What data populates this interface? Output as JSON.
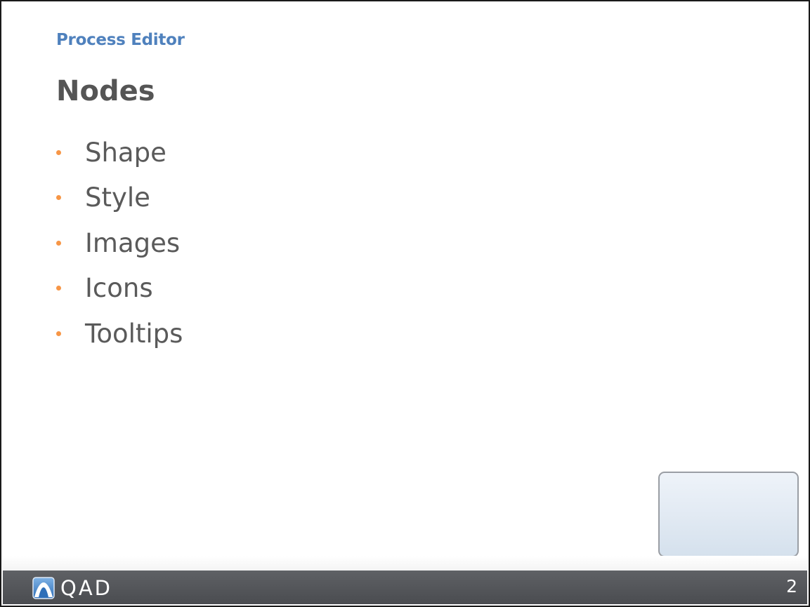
{
  "slide": {
    "section_label": "Process Editor",
    "title": "Nodes",
    "bullets": [
      "Shape",
      "Style",
      "Images",
      "Icons",
      "Tooltips"
    ],
    "page_number": "2"
  },
  "footer": {
    "logo_text": "QAD",
    "logo_icon": "qad-logo-icon"
  },
  "colors": {
    "section_label": "#4f81bd",
    "bullet_dot": "#f79646",
    "footer_bar": "#505256"
  }
}
